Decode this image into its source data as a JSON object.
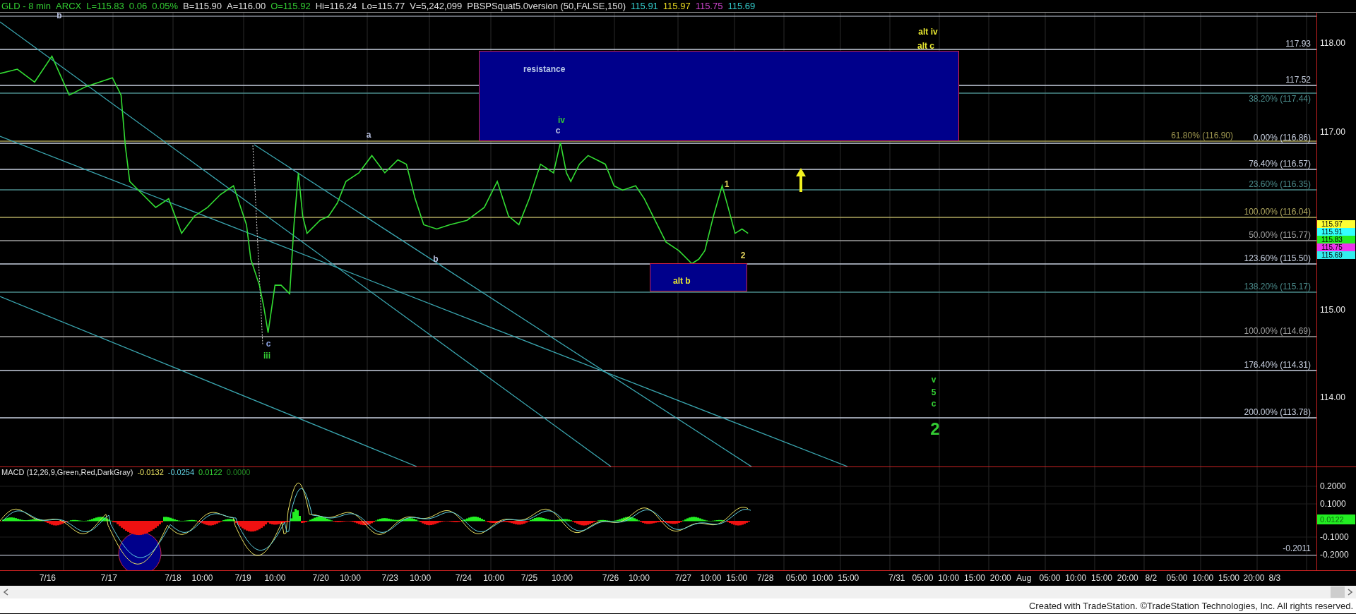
{
  "header": {
    "items": [
      {
        "text": "GLD - 8 min",
        "color": "#33cc33"
      },
      {
        "text": "ARCX",
        "color": "#33cc33"
      },
      {
        "text": "L=115.83",
        "color": "#33cc33"
      },
      {
        "text": "0.06",
        "color": "#33cc33"
      },
      {
        "text": "0.05%",
        "color": "#33cc33"
      },
      {
        "text": "B=115.90",
        "color": "#e0e0e0"
      },
      {
        "text": "A=116.00",
        "color": "#e0e0e0"
      },
      {
        "text": "O=115.92",
        "color": "#33cc33"
      },
      {
        "text": "Hi=116.24",
        "color": "#e0e0e0"
      },
      {
        "text": "Lo=115.77",
        "color": "#e0e0e0"
      },
      {
        "text": "V=5,242,099",
        "color": "#e0e0e0"
      },
      {
        "text": "PBSPSquat5.0version (50,FALSE,150)",
        "color": "#e0e0e0"
      },
      {
        "text": "115.91",
        "color": "#33cccc"
      },
      {
        "text": "115.97",
        "color": "#e8d820"
      },
      {
        "text": "115.75",
        "color": "#cc44cc"
      },
      {
        "text": "115.69",
        "color": "#33cccc"
      }
    ]
  },
  "chart": {
    "annotations": [
      {
        "text": "b",
        "color": "#b8c0e0",
        "kind": "small"
      },
      {
        "text": "a",
        "color": "#b8c0e0",
        "kind": "small"
      },
      {
        "text": "c",
        "color": "#8aa0e0",
        "kind": "small"
      },
      {
        "text": "iii",
        "color": "#33cc33",
        "kind": "small"
      },
      {
        "text": "b",
        "color": "#b8c0e0",
        "kind": "small"
      },
      {
        "text": "iv",
        "color": "#33cc33",
        "kind": "small"
      },
      {
        "text": "c",
        "color": "#b8c0e0",
        "kind": "small"
      },
      {
        "text": "alt iv",
        "color": "#e8e830",
        "kind": "small"
      },
      {
        "text": "alt c",
        "color": "#e8e830",
        "kind": "small"
      },
      {
        "text": "1",
        "color": "#e8d860",
        "kind": "small"
      },
      {
        "text": "2",
        "color": "#e8d860",
        "kind": "small"
      },
      {
        "text": "v",
        "color": "#33cc33",
        "kind": "small"
      },
      {
        "text": "5",
        "color": "#33cc33",
        "kind": "small"
      },
      {
        "text": "c",
        "color": "#33cc33",
        "kind": "small"
      },
      {
        "text": "2",
        "color": "#33cc33",
        "kind": "large"
      }
    ],
    "zones": [
      {
        "label": "resistance",
        "color": "#b8c8e8"
      },
      {
        "label": "alt b",
        "color": "#e8e830"
      }
    ],
    "fib_levels": [
      {
        "label": "117.93",
        "color": "#c8d0e0"
      },
      {
        "label": "117.52",
        "color": "#c8d0e0"
      },
      {
        "label": "38.20% (117.44)",
        "color": "#4a8a8a"
      },
      {
        "label": "61.80% (116.90)",
        "color": "#a09850"
      },
      {
        "label": "0.00% (116.86)",
        "color": "#c8d0e0"
      },
      {
        "label": "76.40% (116.57)",
        "color": "#c8d0e0"
      },
      {
        "label": "23.60% (116.35)",
        "color": "#4a8a8a"
      },
      {
        "label": "100.00% (116.04)",
        "color": "#b0a860"
      },
      {
        "label": "50.00% (115.77)",
        "color": "#a0a0a0"
      },
      {
        "label": "123.60% (115.50)",
        "color": "#c8d0e0"
      },
      {
        "label": "138.20% (115.17)",
        "color": "#4a8a8a"
      },
      {
        "label": "100.00% (114.69)",
        "color": "#a0a0a0"
      },
      {
        "label": "176.40% (114.31)",
        "color": "#c8d0e0"
      },
      {
        "label": "200.00% (113.78)",
        "color": "#c8d0e0"
      }
    ],
    "price_axis": {
      "ticks": [
        "118.00",
        "117.00",
        "115.00",
        "114.00"
      ],
      "tags": [
        {
          "text": "115.97",
          "color": "#ffff33"
        },
        {
          "text": "115.91",
          "color": "#33ffff"
        },
        {
          "text": "115.83",
          "color": "#22ee22"
        },
        {
          "text": "115.75",
          "color": "#ee33ee"
        },
        {
          "text": "115.69",
          "color": "#33eeee"
        }
      ]
    }
  },
  "macd": {
    "title": "MACD (12,26,9,Green,Red,DarkGray)",
    "values": [
      {
        "text": "-0.0132",
        "color": "#e8e060"
      },
      {
        "text": "-0.0254",
        "color": "#60d0e0"
      },
      {
        "text": "0.0122",
        "color": "#33cc33"
      },
      {
        "text": "0.0000",
        "color": "#228822"
      }
    ],
    "ticks": [
      "0.2000",
      "0.1000",
      "-0.1000",
      "-0.2000"
    ],
    "tag": "0.0122",
    "line_label": "-0.2011"
  },
  "time_axis": {
    "labels": [
      "7/16",
      "7/17",
      "7/18",
      "10:00",
      "7/19",
      "10:00",
      "7/20",
      "10:00",
      "7/23",
      "10:00",
      "7/24",
      "10:00",
      "7/25",
      "10:00",
      "7/26",
      "10:00",
      "7/27",
      "10:00",
      "15:00",
      "7/28",
      "05:00",
      "10:00",
      "15:00",
      "7/31",
      "05:00",
      "10:00",
      "15:00",
      "20:00",
      "Aug",
      "05:00",
      "10:00",
      "15:00",
      "20:00",
      "8/2",
      "05:00",
      "10:00",
      "15:00",
      "20:00",
      "8/3"
    ]
  },
  "footer": "Created with TradeStation. ©TradeStation Technologies, Inc. All rights reserved."
}
